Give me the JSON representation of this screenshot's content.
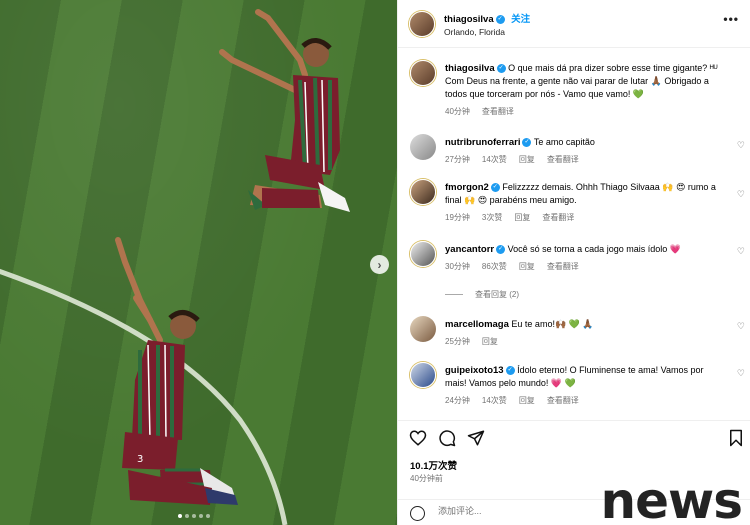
{
  "post": {
    "username": "thiagosilva",
    "follow_label": "关注",
    "location": "Orlando, Florida",
    "more_label": "•••"
  },
  "caption": {
    "username": "thiagosilva",
    "text": "O que mais dá pra dizer sobre esse time gigante? ᴴᵁ Com Deus na frente, a gente não vai parar de lutar 🙏🏾 Obrigado a todos que torceram por nós - Vamo que vamo! 💚",
    "time": "40分钟",
    "translate": "查看翻译"
  },
  "comments": [
    {
      "username": "nutribrunoferrari",
      "verified": true,
      "text": "Te amo capitão",
      "time": "27分钟",
      "likes": "14次赞",
      "reply": "回复",
      "translate": "查看翻译"
    },
    {
      "username": "fmorgon2",
      "verified": true,
      "text": "Felizzzzz demais. Ohhh Thiago Silvaaa 🙌 😍 rumo a final 🙌 😍 parabéns meu amigo.",
      "time": "19分钟",
      "likes": "3次赞",
      "reply": "回复",
      "translate": "查看翻译"
    },
    {
      "username": "yancantorr",
      "verified": true,
      "text": "Você só se torna a cada jogo mais ídolo 💗",
      "time": "30分钟",
      "likes": "86次赞",
      "reply": "回复",
      "translate": "查看翻译",
      "view_replies": "查看回复 (2)"
    },
    {
      "username": "marcellomaga",
      "verified": false,
      "text": "Eu te amo!🙌🏾 💚 🙏🏾",
      "time": "25分钟",
      "reply": "回复"
    },
    {
      "username": "guipeixoto13",
      "verified": true,
      "text": "Ídolo eterno! O Fluminense te ama! Vamos por mais! Vamos pelo mundo! 💗 💚",
      "time": "24分钟",
      "likes": "14次赞",
      "reply": "回复",
      "translate": "查看翻译"
    }
  ],
  "footer": {
    "likes": "10.1万次赞",
    "time": "40分钟前",
    "comment_placeholder": "添加评论..."
  },
  "watermark": "news",
  "colors": {
    "accent": "#0095f6",
    "verified": "#1d9bf0",
    "pitch": "#456f30"
  }
}
